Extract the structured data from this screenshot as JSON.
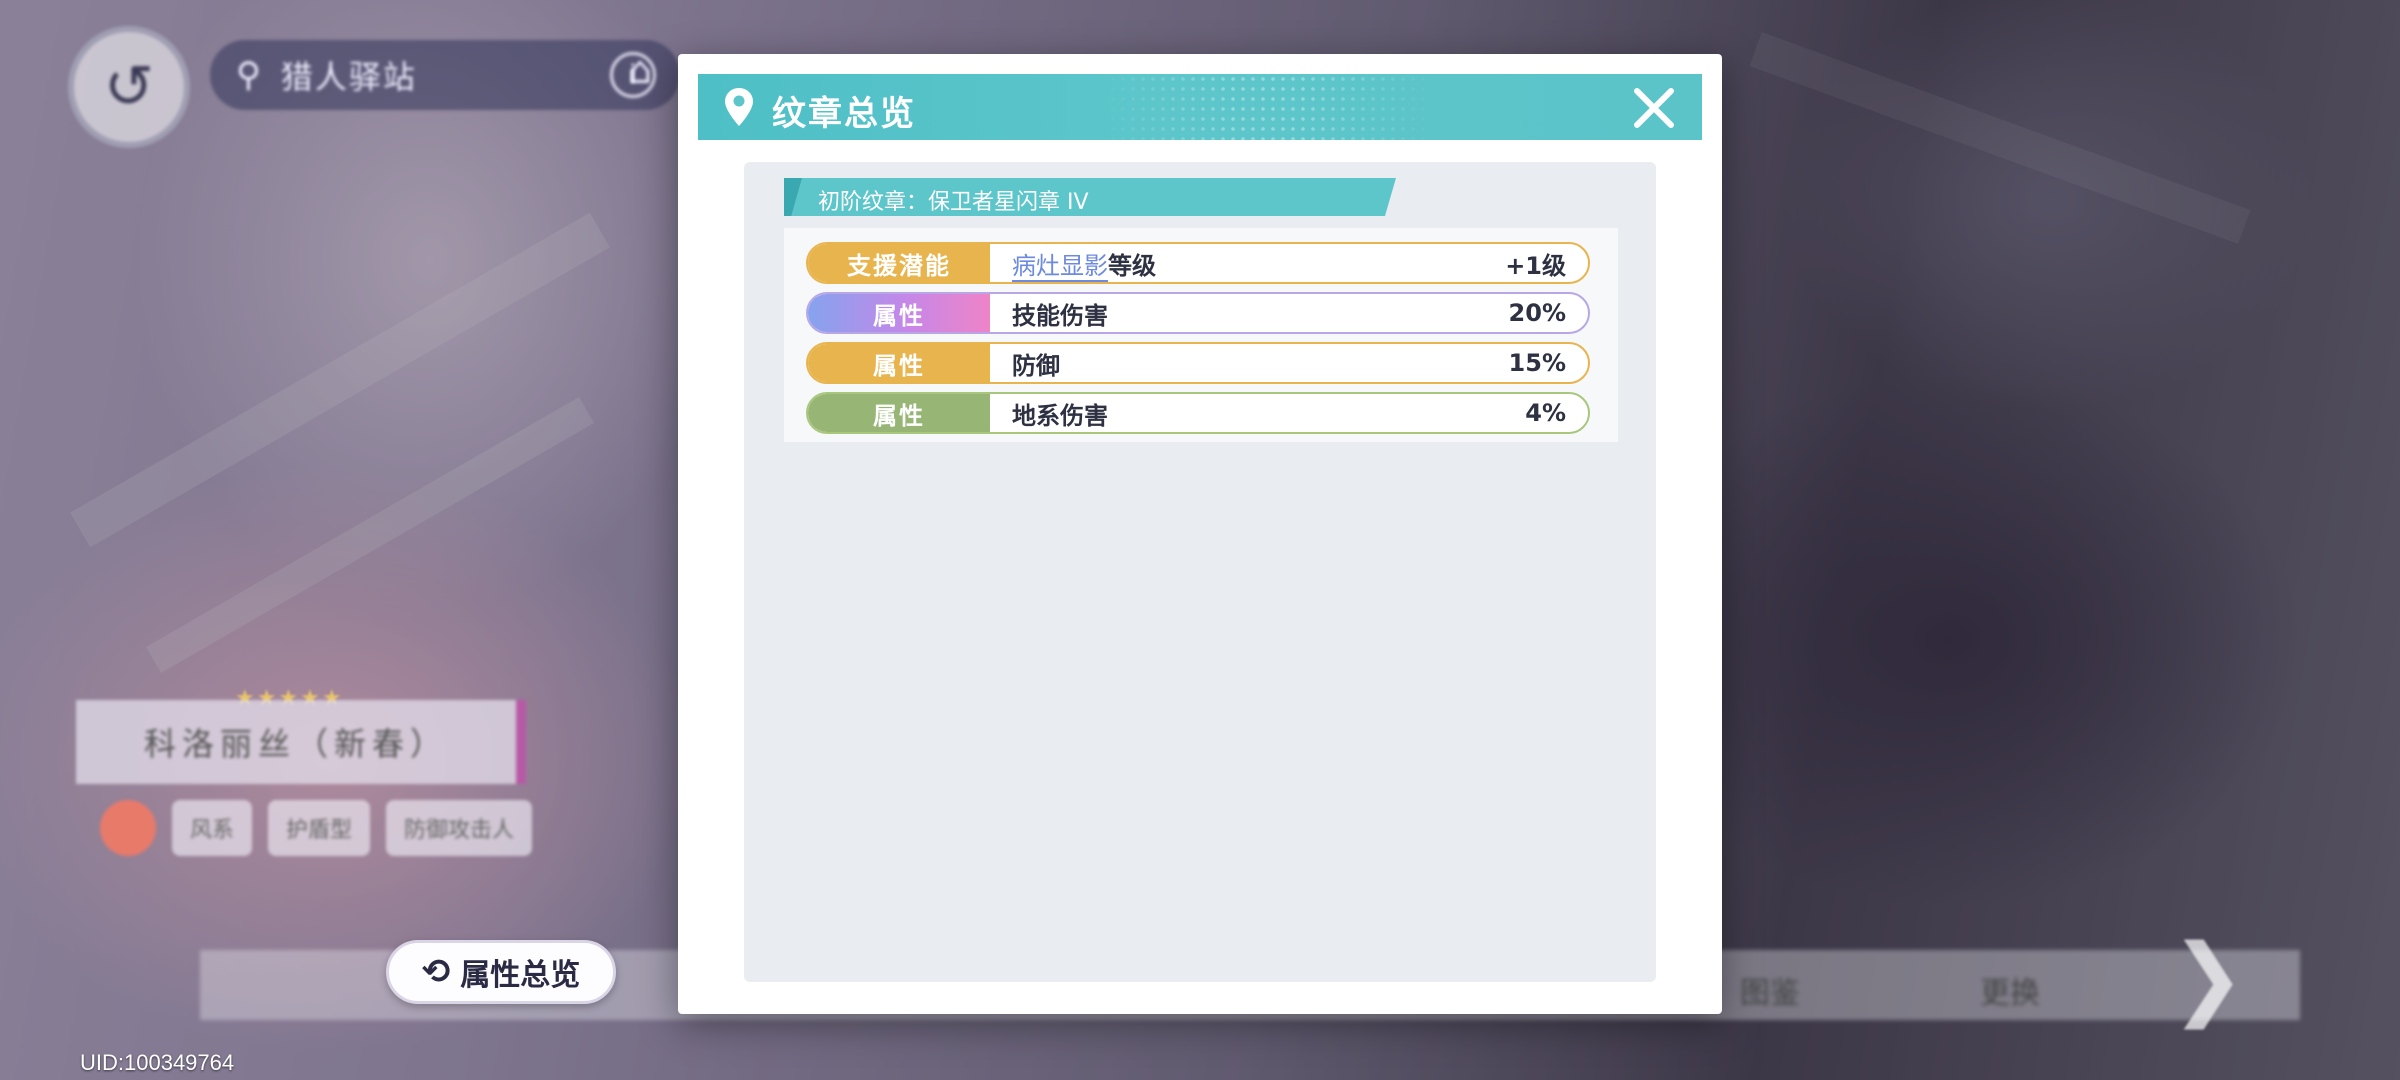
{
  "background": {
    "back_icon": "back-arrow-icon",
    "location_text": "猎人驿站",
    "character_name": "科洛丽丝（新春）",
    "character_tags": [
      "风系",
      "护盾型",
      "防御攻击人"
    ],
    "bottom_items": [
      "图鉴",
      "更换"
    ]
  },
  "attribute_button": {
    "icon": "sync-icon",
    "label": "属性总览"
  },
  "uid": "UID:100349764",
  "modal": {
    "icon": "location-pin-icon",
    "title": "纹章总览",
    "close_icon": "close-icon",
    "badge_title": "初阶纹章：保卫者星闪章 IV",
    "stats": [
      {
        "tag": "支援潜能",
        "name_highlight": "病灶显影",
        "name": "等级",
        "value": "+1级",
        "style": "orange"
      },
      {
        "tag": "属性",
        "name_highlight": "",
        "name": "技能伤害",
        "value": "20%",
        "style": "gradient"
      },
      {
        "tag": "属性",
        "name_highlight": "",
        "name": "防御",
        "value": "15%",
        "style": "orange"
      },
      {
        "tag": "属性",
        "name_highlight": "",
        "name": "地系伤害",
        "value": "4%",
        "style": "green"
      }
    ]
  },
  "colors": {
    "header_teal": "#5cc6cb",
    "orange_tag": "#e8b44e",
    "green_tag": "#97b676",
    "gradient_tag_start": "#85a3ee",
    "gradient_tag_end": "#ef84c7",
    "highlight_link": "#6b8ae0"
  }
}
